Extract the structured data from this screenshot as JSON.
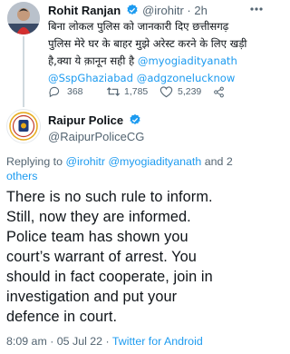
{
  "colors": {
    "link": "#1d9bf0",
    "muted": "#536471",
    "text": "#0f1419",
    "verified": "#1d9bf0"
  },
  "parent_tweet": {
    "author_name": "Rohit Ranjan",
    "handle_time": "@irohitr · 2h",
    "line1": "बिना लोकल पुलिस को जानकारी दिए छत्तीसगढ़",
    "line2": "पुलिस मेरे घर के बाहर मुझे अरेस्ट करने के लिए खड़ी",
    "line3_text": "है,क्या ये क़ानून सही है ",
    "mention1": "@myogiadityanath",
    "mention2": "@SspGhaziabad",
    "mention3": "@adgzonelucknow",
    "replies": "368",
    "retweets": "1,785",
    "likes": "5,239",
    "icons": [
      "reply-icon",
      "retweet-icon",
      "like-icon",
      "share-icon",
      "verified-icon",
      "more-icon"
    ]
  },
  "main_tweet": {
    "author_name": "Raipur Police",
    "handle": "@RaipurPoliceCG",
    "replying_prefix": "Replying to ",
    "replying_mention1": "@irohitr",
    "replying_mention2": "@myogiadityanath",
    "replying_and": " and 2",
    "replying_others": "others",
    "body_lines": [
      "There is no such rule to inform.",
      "Still, now they are informed.",
      "Police team has shown you",
      "court’s warrant of arrest. You",
      "should in fact cooperate, join in",
      "investigation and put your",
      "defence in court."
    ],
    "timestamp": "8:09 am · 05 Jul 22 · ",
    "source": "Twitter for Android"
  }
}
